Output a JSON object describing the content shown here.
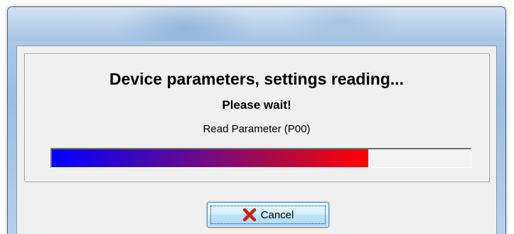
{
  "dialog": {
    "heading": "Device parameters, settings reading...",
    "subheading": "Please wait!",
    "status_text": "Read Parameter (P00)",
    "progress": {
      "value_fraction": 0.755,
      "start_color": "#0000ff",
      "end_color": "#ff0000"
    },
    "cancel_button": {
      "label": "Cancel",
      "icon": "red-x-icon",
      "icon_color": "#c8201a"
    }
  }
}
